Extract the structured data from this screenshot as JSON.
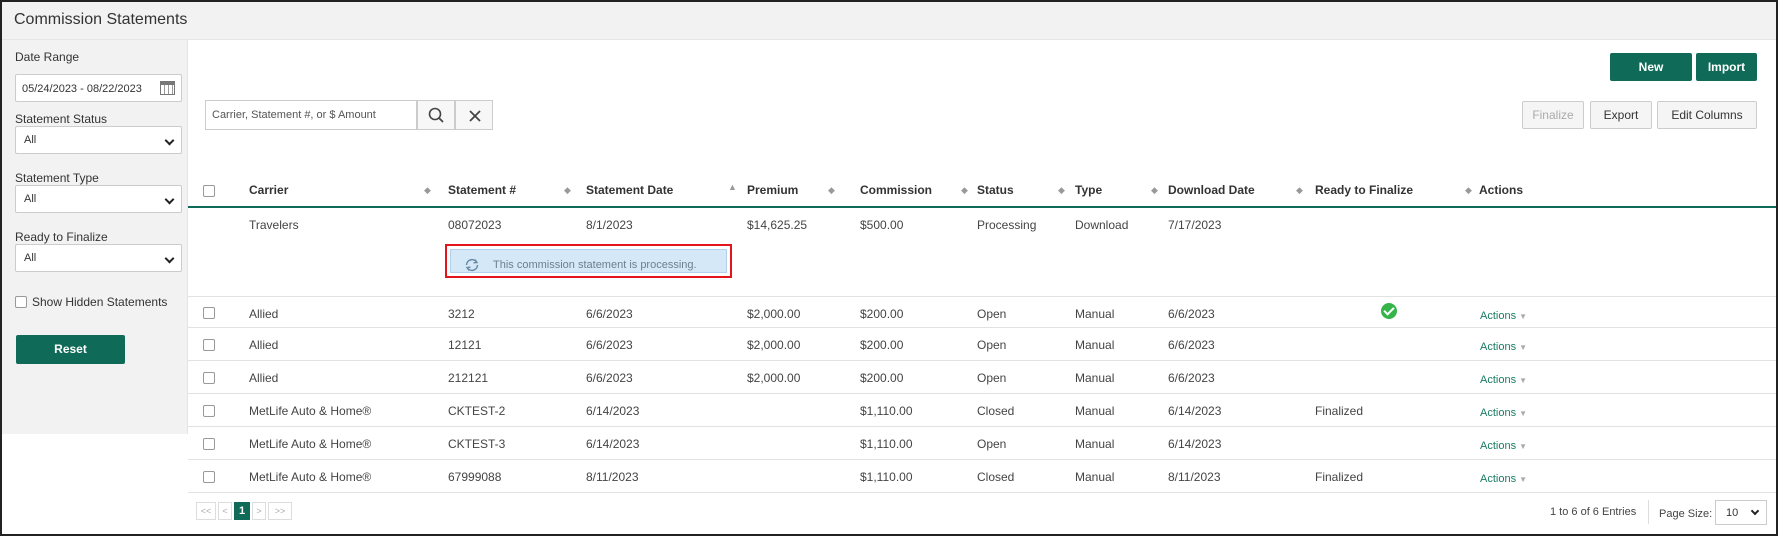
{
  "window": {
    "title": "Commission Statements"
  },
  "sidebar": {
    "date_range_label": "Date Range",
    "date_range_value": "05/24/2023 - 08/22/2023",
    "statement_status_label": "Statement Status",
    "statement_status_value": "All",
    "statement_type_label": "Statement Type",
    "statement_type_value": "All",
    "ready_label": "Ready to Finalize",
    "ready_value": "All",
    "show_hidden_label": "Show Hidden Statements",
    "reset_label": "Reset"
  },
  "toolbar": {
    "new_label": "New",
    "import_label": "Import",
    "finalize_label": "Finalize",
    "export_label": "Export",
    "edit_columns_label": "Edit Columns",
    "search_placeholder": "Carrier, Statement #, or $ Amount"
  },
  "colors": {
    "accent": "#0f6b57",
    "highlight_border": "#e4141b",
    "processing_bg": "#d5e8f7",
    "check_green": "#35b44a"
  },
  "table": {
    "columns": [
      "Carrier",
      "Statement #",
      "Statement Date",
      "Premium",
      "Commission",
      "Status",
      "Type",
      "Download Date",
      "Ready to Finalize",
      "Actions"
    ],
    "processing_message": "This commission statement is processing.",
    "rows": [
      {
        "carrier": "Travelers",
        "statement": "08072023",
        "date": "8/1/2023",
        "premium": "$14,625.25",
        "commission": "$500.00",
        "status": "Processing",
        "type": "Download",
        "download_date": "7/17/2023",
        "ready": "",
        "actions": ""
      },
      {
        "carrier": "Allied",
        "statement": "3212",
        "date": "6/6/2023",
        "premium": "$2,000.00",
        "commission": "$200.00",
        "status": "Open",
        "type": "Manual",
        "download_date": "6/6/2023",
        "ready": "",
        "actions": "Actions"
      },
      {
        "carrier": "Allied",
        "statement": "12121",
        "date": "6/6/2023",
        "premium": "$2,000.00",
        "commission": "$200.00",
        "status": "Open",
        "type": "Manual",
        "download_date": "6/6/2023",
        "ready": "",
        "actions": "Actions"
      },
      {
        "carrier": "Allied",
        "statement": "212121",
        "date": "6/6/2023",
        "premium": "$2,000.00",
        "commission": "$200.00",
        "status": "Open",
        "type": "Manual",
        "download_date": "6/6/2023",
        "ready": "",
        "actions": "Actions"
      },
      {
        "carrier": "MetLife Auto & Home®",
        "statement": "CKTEST-2",
        "date": "6/14/2023",
        "premium": "",
        "commission": "$1,110.00",
        "status": "Closed",
        "type": "Manual",
        "download_date": "6/14/2023",
        "ready": "Finalized",
        "actions": "Actions"
      },
      {
        "carrier": "MetLife Auto & Home®",
        "statement": "CKTEST-3",
        "date": "6/14/2023",
        "premium": "",
        "commission": "$1,110.00",
        "status": "Open",
        "type": "Manual",
        "download_date": "6/14/2023",
        "ready": "",
        "actions": "Actions"
      },
      {
        "carrier": "MetLife Auto & Home®",
        "statement": "67999088",
        "date": "8/11/2023",
        "premium": "",
        "commission": "$1,110.00",
        "status": "Closed",
        "type": "Manual",
        "download_date": "8/11/2023",
        "ready": "Finalized",
        "actions": "Actions"
      }
    ]
  },
  "pagination": {
    "first": "<<",
    "prev": "<",
    "current": "1",
    "next": ">",
    "last": ">>",
    "entries_text": "1 to 6 of 6 Entries",
    "page_size_label": "Page Size:",
    "page_size_value": "10"
  }
}
